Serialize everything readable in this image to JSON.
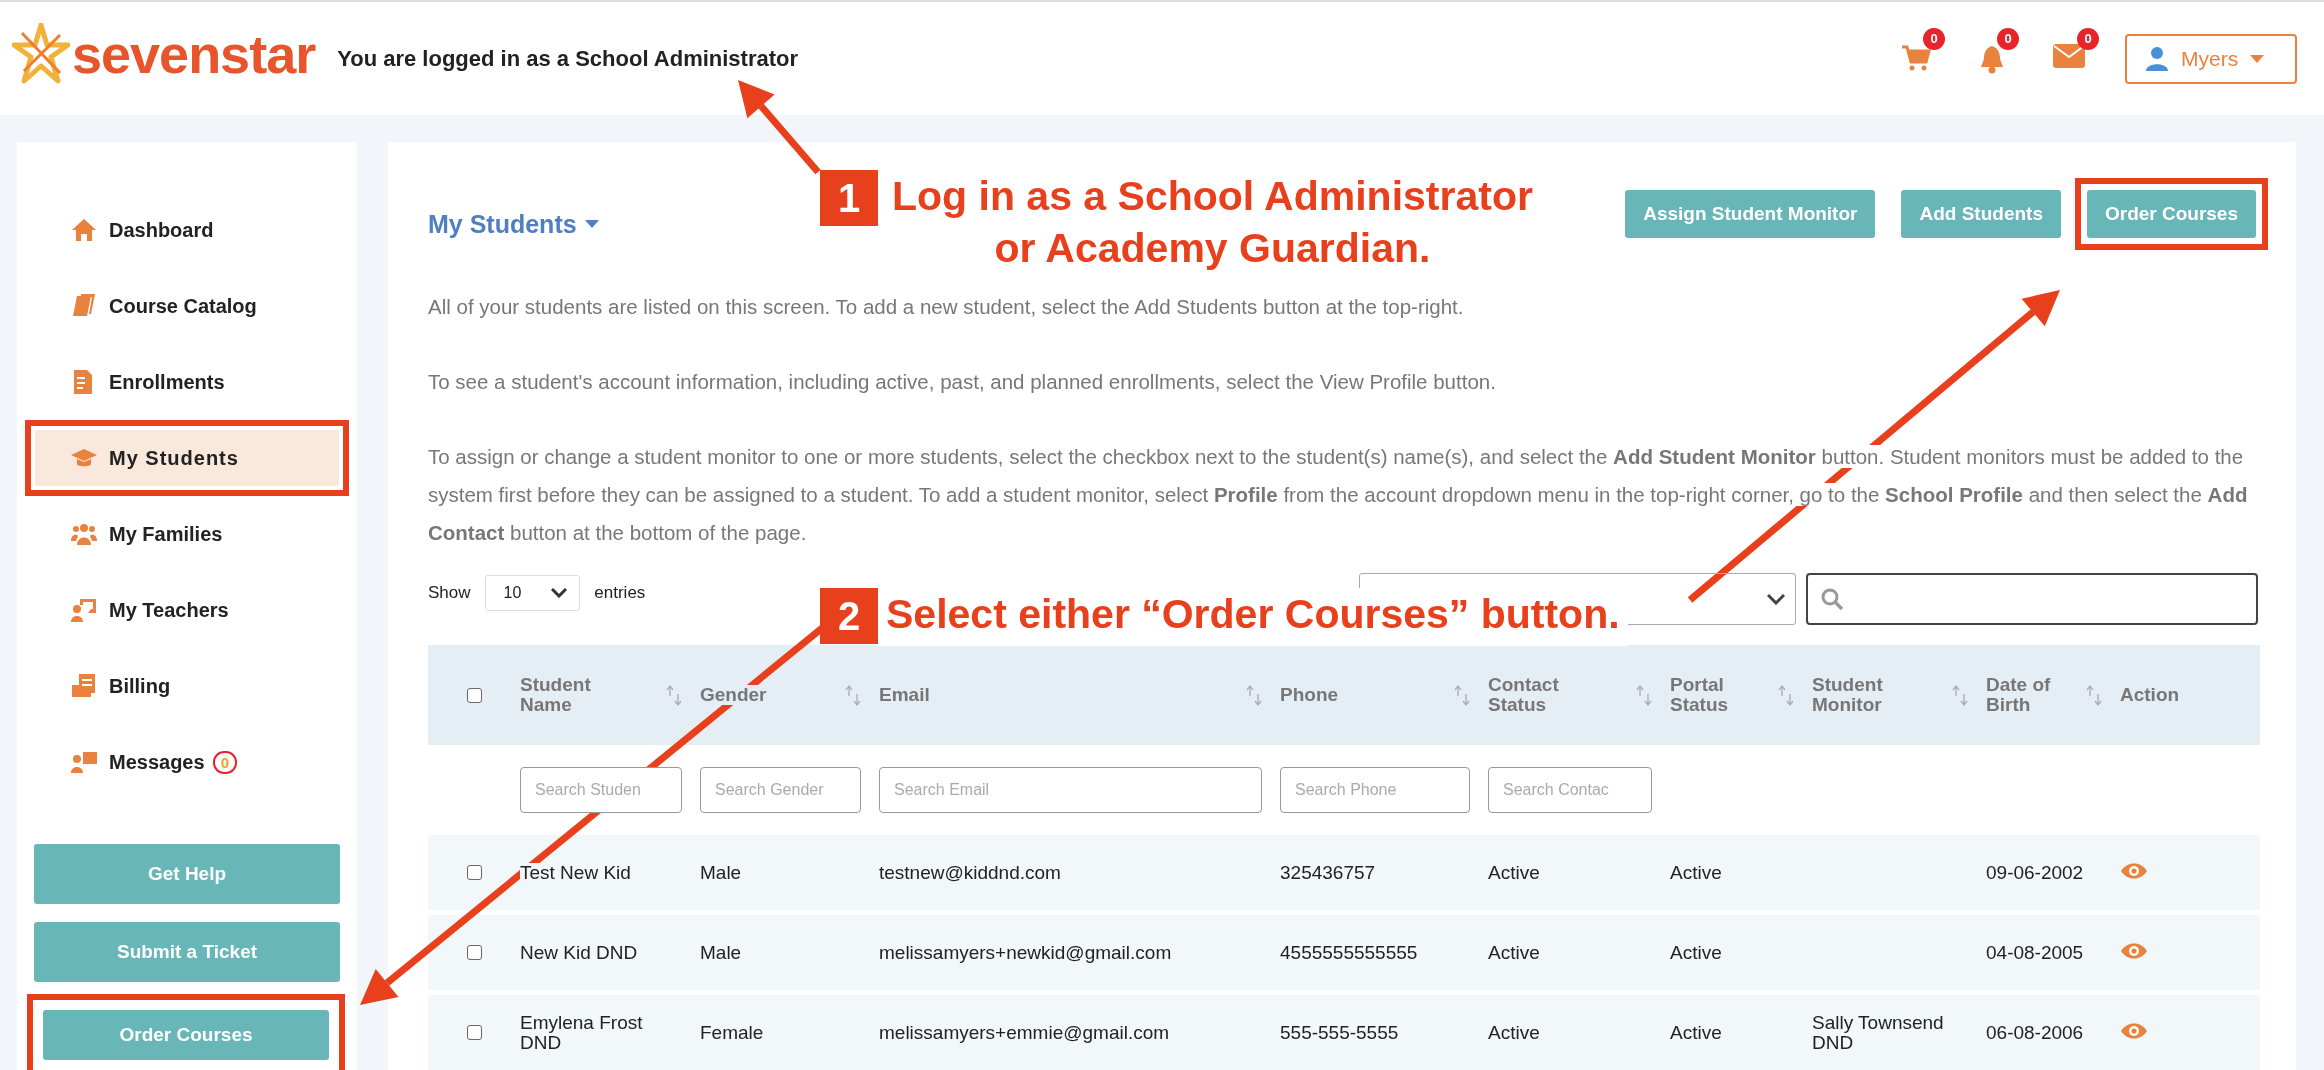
{
  "header": {
    "logo": "sevenstar",
    "login_text": "You are logged in as a School Administrator",
    "counters": [
      {
        "kind": "cart",
        "count": "0"
      },
      {
        "kind": "bell",
        "count": "0"
      },
      {
        "kind": "mail",
        "count": "0"
      }
    ],
    "user": "Myers"
  },
  "sidebar": {
    "items": [
      {
        "label": "Dashboard",
        "selected": false,
        "highlighted": false
      },
      {
        "label": "Course Catalog",
        "selected": false,
        "highlighted": false
      },
      {
        "label": "Enrollments",
        "selected": false,
        "highlighted": false
      },
      {
        "label": "My Students",
        "selected": true,
        "highlighted": true
      },
      {
        "label": "My Families",
        "selected": false,
        "highlighted": false
      },
      {
        "label": "My Teachers",
        "selected": false,
        "highlighted": false
      },
      {
        "label": "Billing",
        "selected": false,
        "highlighted": false
      },
      {
        "label": "Messages",
        "selected": false,
        "highlighted": false,
        "badge": "0"
      }
    ],
    "buttons": [
      {
        "label": "Get Help",
        "highlighted": false
      },
      {
        "label": "Submit a Ticket",
        "highlighted": false
      },
      {
        "label": "Order Courses",
        "highlighted": true
      }
    ]
  },
  "main": {
    "title": "My Students",
    "buttons": [
      {
        "label": "Assign Student Monitor",
        "highlighted": false
      },
      {
        "label": "Add Students",
        "highlighted": false
      },
      {
        "label": "Order Courses",
        "highlighted": true
      }
    ],
    "paragraphs": [
      "All of your students are listed on this screen. To add a new student, select the Add Students button at the top-right.",
      "To see a student's account information, including active, past, and planned enrollments, select the View Profile button.",
      "To assign or change a student monitor to one or more students, select the checkbox next to the student(s) name(s), and select the **Add Student Monitor** button. Student monitors must be added to the system first before they can be assigned to a student. To add a student monitor, select **Profile** from the account dropdown menu in the top-right corner, go to the **School Profile** and then select the **Add Contact** button at the bottom of the page."
    ],
    "length": {
      "prefix": "Show",
      "value": "10",
      "suffix": "entries"
    },
    "table": {
      "columns": [
        {
          "label": "Student Name",
          "sortable": true
        },
        {
          "label": "Gender",
          "sortable": true
        },
        {
          "label": "Email",
          "sortable": true
        },
        {
          "label": "Phone",
          "sortable": true
        },
        {
          "label": "Contact Status",
          "sortable": true
        },
        {
          "label": "Portal Status",
          "sortable": true
        },
        {
          "label": "Student Monitor",
          "sortable": true
        },
        {
          "label": "Date of Birth",
          "sortable": true
        },
        {
          "label": "Action",
          "sortable": false
        }
      ],
      "select_all_checked": false,
      "placeholders": [
        "Search Studen",
        "Search Gender",
        "Search Email",
        "Search Phone",
        "Search Contac"
      ],
      "rows": [
        {
          "checked": false,
          "cells": [
            "Test New Kid",
            "Male",
            "testnew@kiddnd.com",
            "325436757",
            "Active",
            "Active",
            "",
            "09-06-2002"
          ]
        },
        {
          "checked": false,
          "cells": [
            "New Kid DND",
            "Male",
            "melissamyers+newkid@gmail.com",
            "4555555555555",
            "Active",
            "Active",
            "",
            "04-08-2005"
          ]
        },
        {
          "checked": false,
          "cells": [
            "Emylena Frost DND",
            "Female",
            "melissamyers+emmie@gmail.com",
            "555-555-5555",
            "Active",
            "Active",
            "Sally Townsend DND",
            "06-08-2006"
          ]
        }
      ]
    }
  },
  "annotations": [
    {
      "number": "1",
      "lines": [
        "Log in as a School Administrator",
        "or Academy Guardian."
      ]
    },
    {
      "number": "2",
      "lines": [
        "Select either “Order Courses” button."
      ]
    }
  ]
}
